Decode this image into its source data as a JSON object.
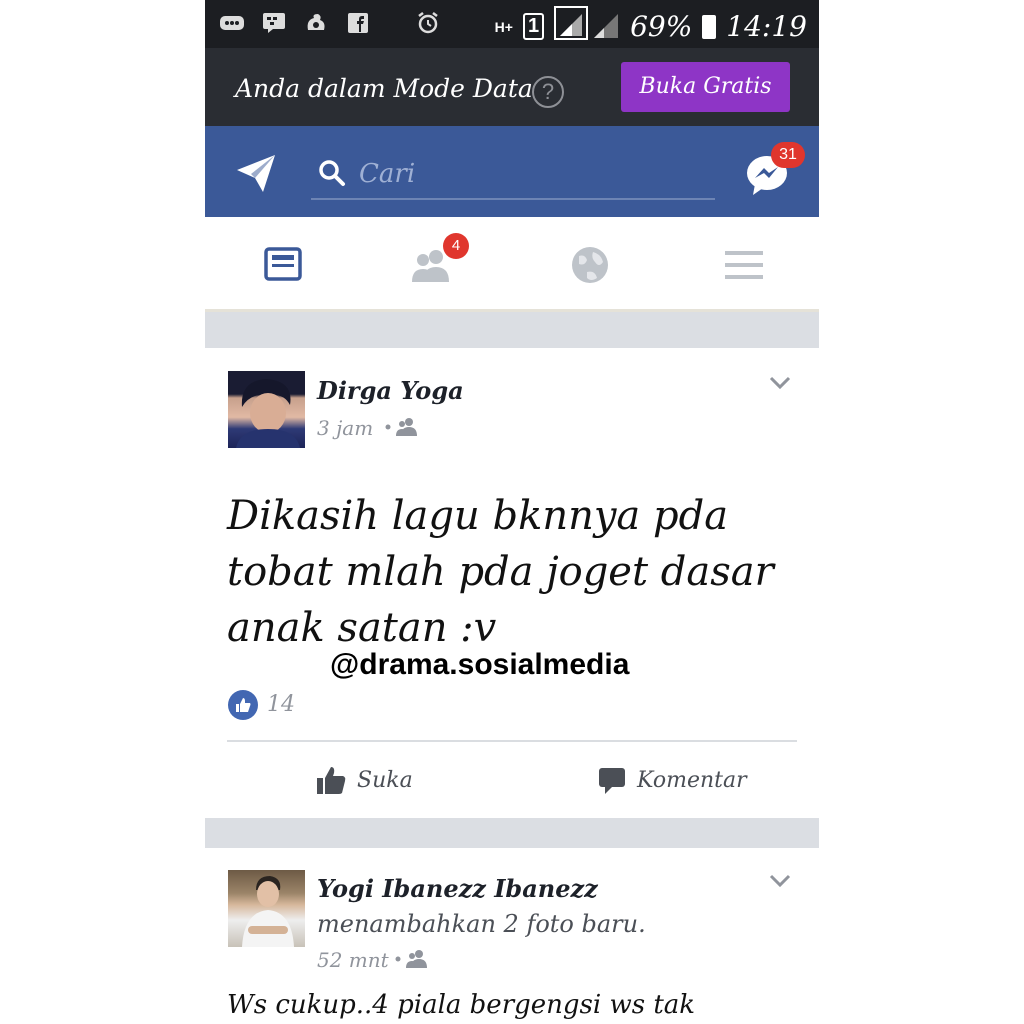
{
  "status_bar": {
    "battery": "69%",
    "time": "14:19",
    "network": "H+",
    "sim": "1"
  },
  "data_mode": {
    "message": "Anda dalam Mode Data",
    "help": "?",
    "button": "Buka Gratis"
  },
  "header": {
    "search_placeholder": "Cari",
    "messenger_badge": "31"
  },
  "nav": {
    "friend_requests_badge": "4"
  },
  "posts": [
    {
      "author": "Dirga Yoga",
      "time": "3 jam",
      "text": "Dikasih lagu bknnya pda tobat mlah pda joget dasar anak satan :v",
      "likes": "14",
      "like_label": "Suka",
      "comment_label": "Komentar"
    },
    {
      "author": "Yogi Ibanezz Ibanezz",
      "subline": "menambahkan 2 foto baru.",
      "time": "52 mnt",
      "text": "Ws cukup..4 piala bergengsi ws tak"
    }
  ],
  "watermark": "@drama.sosialmedia",
  "colors": {
    "facebook_blue": "#3b5998",
    "data_button": "#8e35c6",
    "badge_red": "#e0362d",
    "like_blue": "#4267b2"
  }
}
